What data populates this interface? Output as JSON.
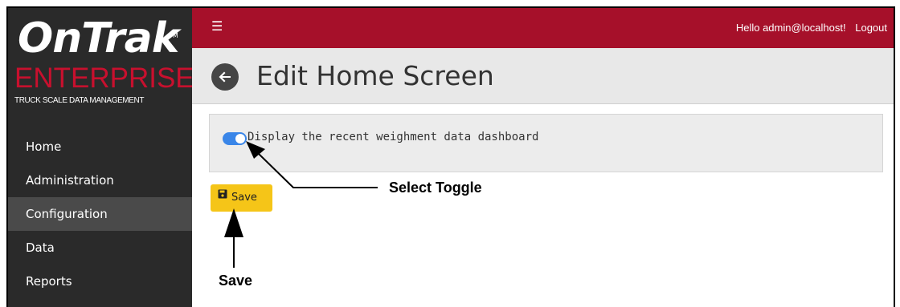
{
  "brand": {
    "name": "OnTrak",
    "tm": "TM",
    "product": "ENTERPRISE",
    "tagline": "TRUCK SCALE DATA MANAGEMENT",
    "accent_color": "#c8102e"
  },
  "topbar": {
    "menu_icon": "hamburger-icon",
    "greeting": "Hello admin@localhost!",
    "logout_label": "Logout",
    "background_color": "#a6102a"
  },
  "sidebar": {
    "items": [
      {
        "label": "Home",
        "active": false
      },
      {
        "label": "Administration",
        "active": false
      },
      {
        "label": "Configuration",
        "active": true
      },
      {
        "label": "Data",
        "active": false
      },
      {
        "label": "Reports",
        "active": false
      }
    ]
  },
  "header": {
    "back_icon": "arrow-left-circle-icon",
    "title": "Edit Home Screen"
  },
  "settings": {
    "dashboard_toggle": {
      "label": "Display the recent weighment data dashboard",
      "checked": true,
      "color": "#3a86e8"
    }
  },
  "actions": {
    "save_icon": "floppy-disk-icon",
    "save_label": "Save",
    "save_color": "#f5c518"
  },
  "annotations": {
    "toggle_callout": "Select Toggle",
    "save_callout": "Save"
  }
}
